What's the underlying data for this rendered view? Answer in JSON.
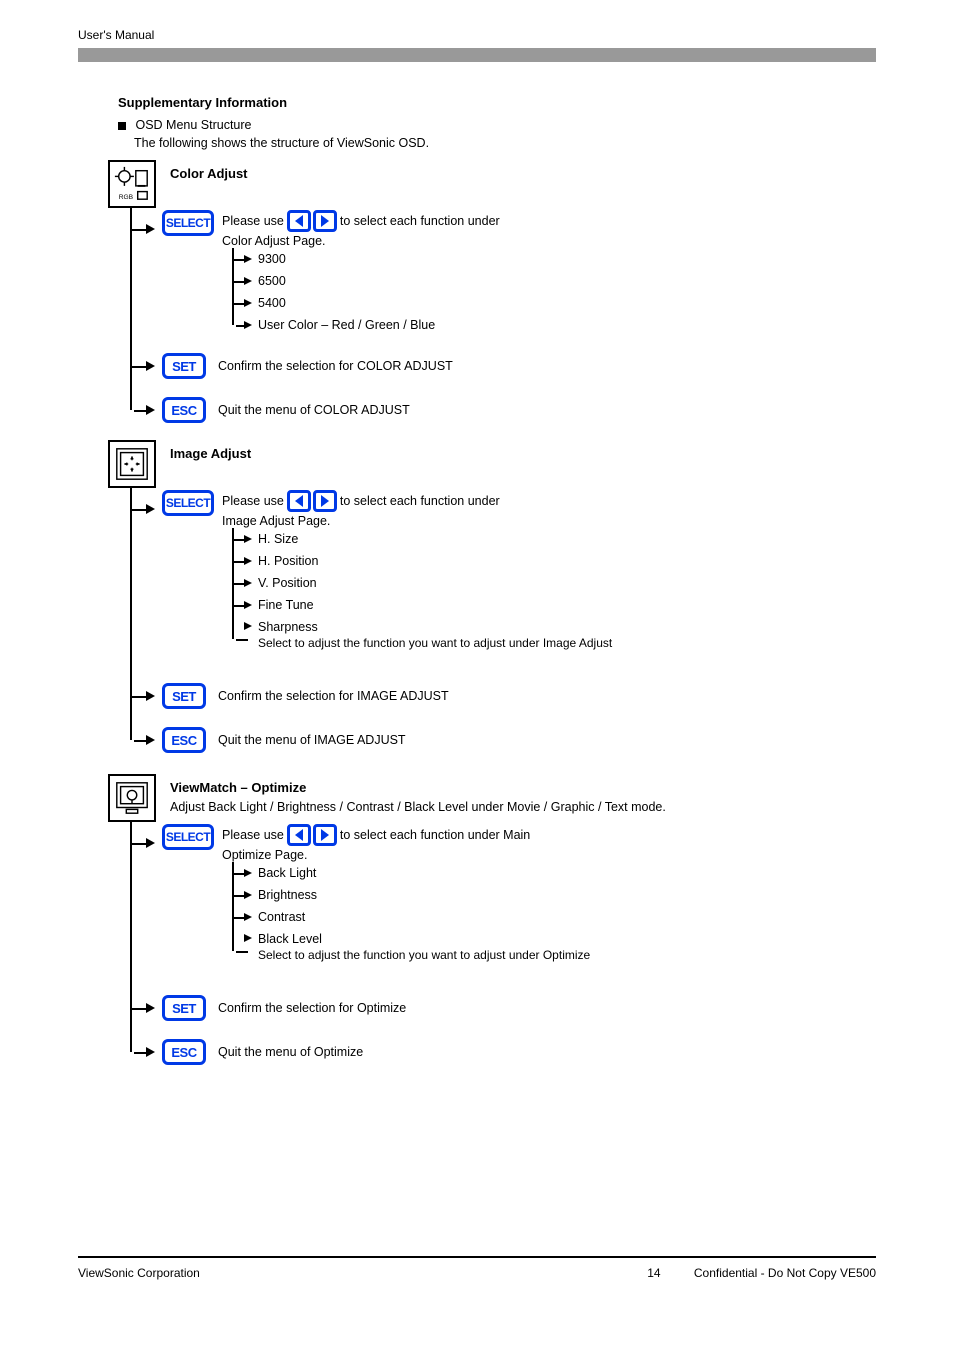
{
  "header": {
    "text": "User's Manual"
  },
  "intro": {
    "title": "Supplementary Information",
    "line1": "OSD Menu Structure",
    "line2": "The following shows the structure of ViewSonic OSD."
  },
  "buttons": {
    "select": "SELECT",
    "set": "SET",
    "esc": "ESC"
  },
  "arrows_note_prefix": "Please use ",
  "arrows_note_suffix_generic": " to select each function under",
  "arrows_note_suffix_main": " to select each function under Main",
  "menus": [
    {
      "id": "color",
      "title": "Color Adjust",
      "subtitle": "",
      "select_l2": "Color Adjust Page.",
      "items": [
        {
          "label": "9300"
        },
        {
          "label": "6500"
        },
        {
          "label": "5400"
        },
        {
          "label": "User Color – Red / Green / Blue"
        }
      ],
      "set_text": "Confirm the selection for COLOR ADJUST",
      "esc_text": "Quit the menu of COLOR ADJUST"
    },
    {
      "id": "image",
      "title": "Image Adjust",
      "subtitle": "",
      "select_l2": "Image Adjust Page.",
      "items": [
        {
          "label": "H. Size"
        },
        {
          "label": "H. Position"
        },
        {
          "label": "V. Position"
        },
        {
          "label": "Fine Tune"
        },
        {
          "label": "Sharpness",
          "extra": "Select to adjust the function you want to adjust under Image Adjust"
        }
      ],
      "set_text": "Confirm the selection for IMAGE ADJUST",
      "esc_text": "Quit the menu of IMAGE ADJUST"
    },
    {
      "id": "optimize",
      "title": "ViewMatch – Optimize",
      "subtitle": "Adjust Back Light / Brightness / Contrast / Black Level under Movie / Graphic / Text mode.",
      "select_l2": "Optimize Page.",
      "items": [
        {
          "label": "Back Light"
        },
        {
          "label": "Brightness"
        },
        {
          "label": "Contrast"
        },
        {
          "label": "Black Level",
          "extra": "Select to adjust the function you want to adjust under Optimize"
        }
      ],
      "set_text": "Confirm the selection for Optimize",
      "esc_text": "Quit the menu of Optimize"
    }
  ],
  "footer": {
    "left": "ViewSonic Corporation",
    "right": "14",
    "right_suffix": "Confidential - Do Not Copy  VE500"
  }
}
